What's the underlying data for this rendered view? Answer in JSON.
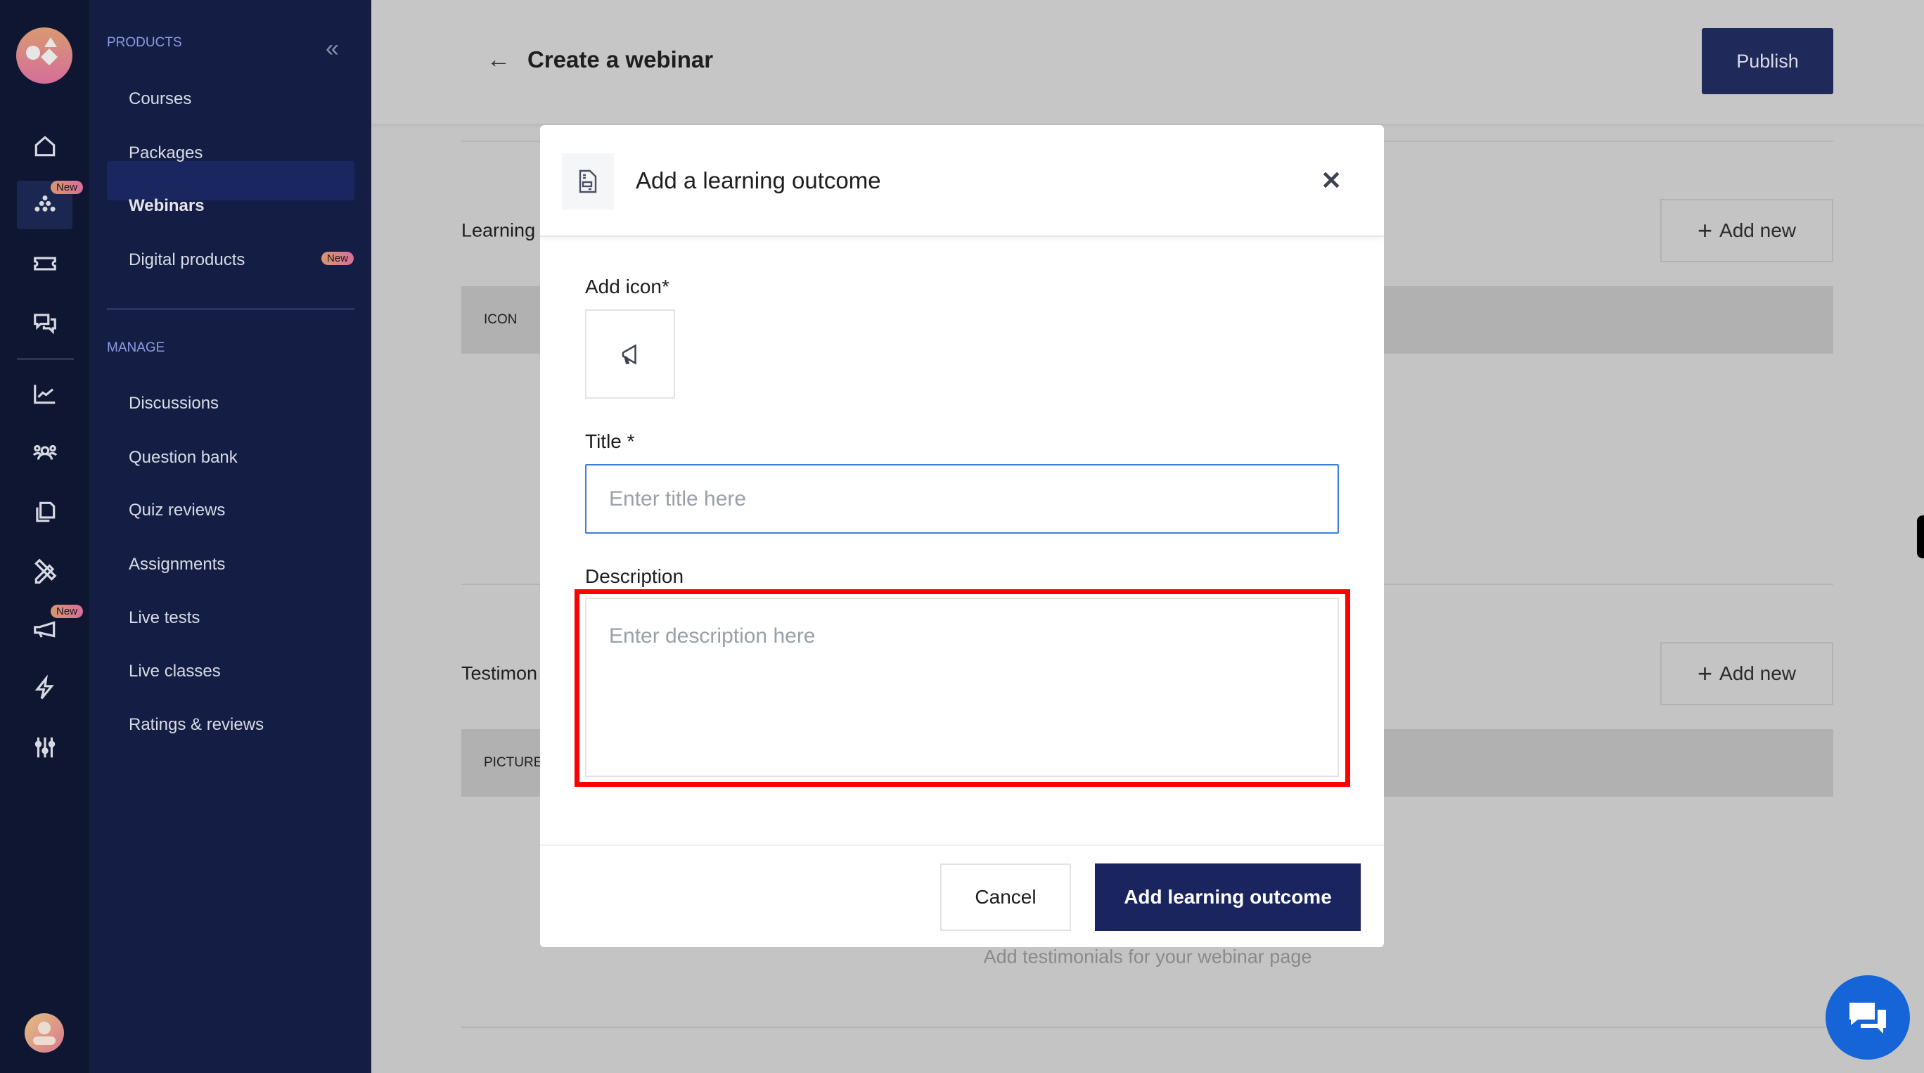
{
  "rail": {
    "new_badge": "New",
    "items": [
      "home",
      "webinars",
      "ticket",
      "chat",
      "analytics",
      "users",
      "copy",
      "tools",
      "megaphone",
      "bolt",
      "sliders"
    ]
  },
  "sidebar": {
    "products_heading": "PRODUCTS",
    "products": [
      {
        "label": "Courses"
      },
      {
        "label": "Packages"
      },
      {
        "label": "Webinars",
        "active": true
      },
      {
        "label": "Digital products",
        "badge": "New"
      }
    ],
    "manage_heading": "MANAGE",
    "manage": [
      {
        "label": "Discussions"
      },
      {
        "label": "Question bank"
      },
      {
        "label": "Quiz reviews"
      },
      {
        "label": "Assignments"
      },
      {
        "label": "Live tests"
      },
      {
        "label": "Live classes"
      },
      {
        "label": "Ratings & reviews"
      }
    ]
  },
  "header": {
    "title": "Create a webinar",
    "publish_label": "Publish"
  },
  "page": {
    "learning_label": "Learning",
    "testimonials_label": "Testimon",
    "add_new_label": "Add new",
    "icon_col": "ICON",
    "picture_col": "PICTURE",
    "testimonials_hint": "Add testimonials for your webinar page"
  },
  "modal": {
    "title": "Add a learning outcome",
    "add_icon_label": "Add icon*",
    "title_label": "Title *",
    "title_placeholder": "Enter title here",
    "title_value": "",
    "description_label": "Description",
    "description_placeholder": "Enter description here",
    "description_value": "",
    "cancel_label": "Cancel",
    "submit_label": "Add learning outcome"
  },
  "colors": {
    "primary": "#1a2560",
    "highlight": "#ff0000",
    "input_focus": "#3b7ddd",
    "chat": "#1565d8"
  }
}
